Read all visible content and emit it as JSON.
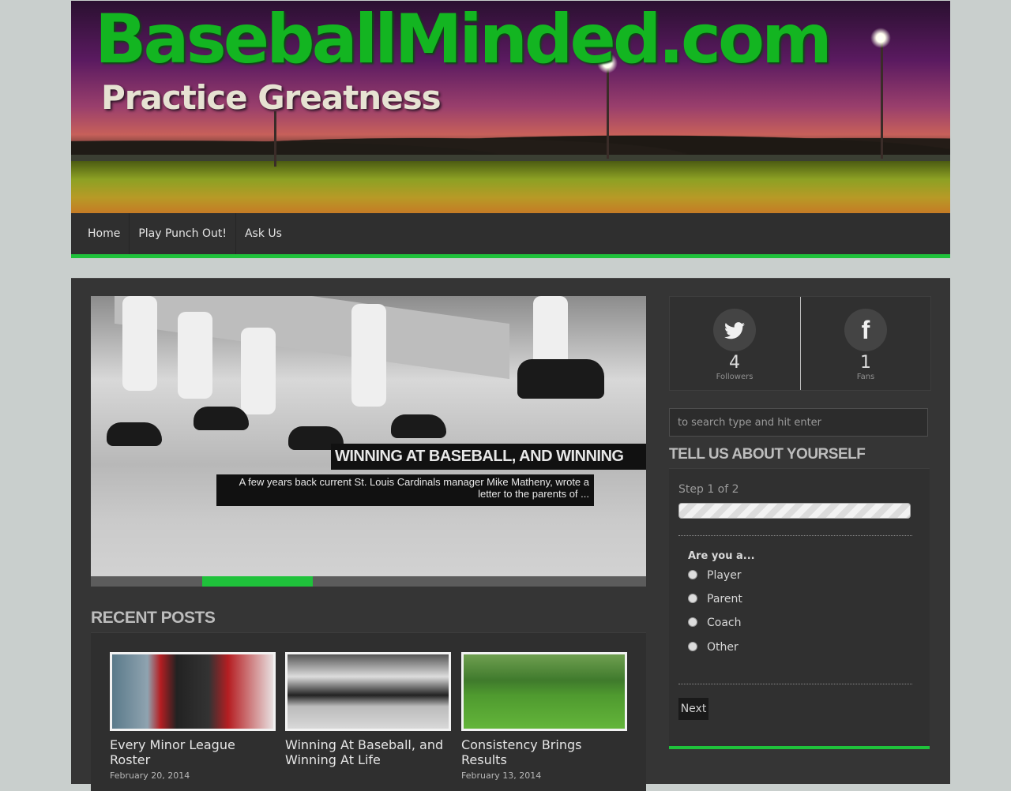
{
  "header": {
    "site_title": "BaseballMinded.com",
    "tagline": "Practice Greatness"
  },
  "nav": {
    "items": [
      {
        "label": "Home"
      },
      {
        "label": "Play Punch Out!"
      },
      {
        "label": "Ask Us"
      }
    ]
  },
  "slider": {
    "title": "Winning At Baseball, and Winning At Life",
    "excerpt": "A few years back current St. Louis Cardinals manager Mike Matheny, wrote a letter to the parents of ...",
    "pager_total": 5,
    "pager_active": 2
  },
  "recent_posts": {
    "heading": "Recent Posts",
    "posts": [
      {
        "title": "Every Minor League Roster",
        "date": "February 20, 2014"
      },
      {
        "title": "Winning At Baseball, and Winning At Life",
        "date": ""
      },
      {
        "title": "Consistency Brings Results",
        "date": "February 13, 2014"
      }
    ]
  },
  "social": {
    "twitter": {
      "icon": "twitter-icon",
      "count": "4",
      "label": "Followers"
    },
    "facebook": {
      "icon": "facebook-icon",
      "count": "1",
      "label": "Fans"
    }
  },
  "search": {
    "placeholder": "to search type and hit enter"
  },
  "survey": {
    "heading": "Tell Us About Yourself",
    "step": "Step 1 of 2",
    "question": "Are you a...",
    "options": [
      "Player",
      "Parent",
      "Coach",
      "Other"
    ],
    "next_label": "Next"
  },
  "colors": {
    "accent": "#1fc23b",
    "title_green": "#13b521"
  }
}
